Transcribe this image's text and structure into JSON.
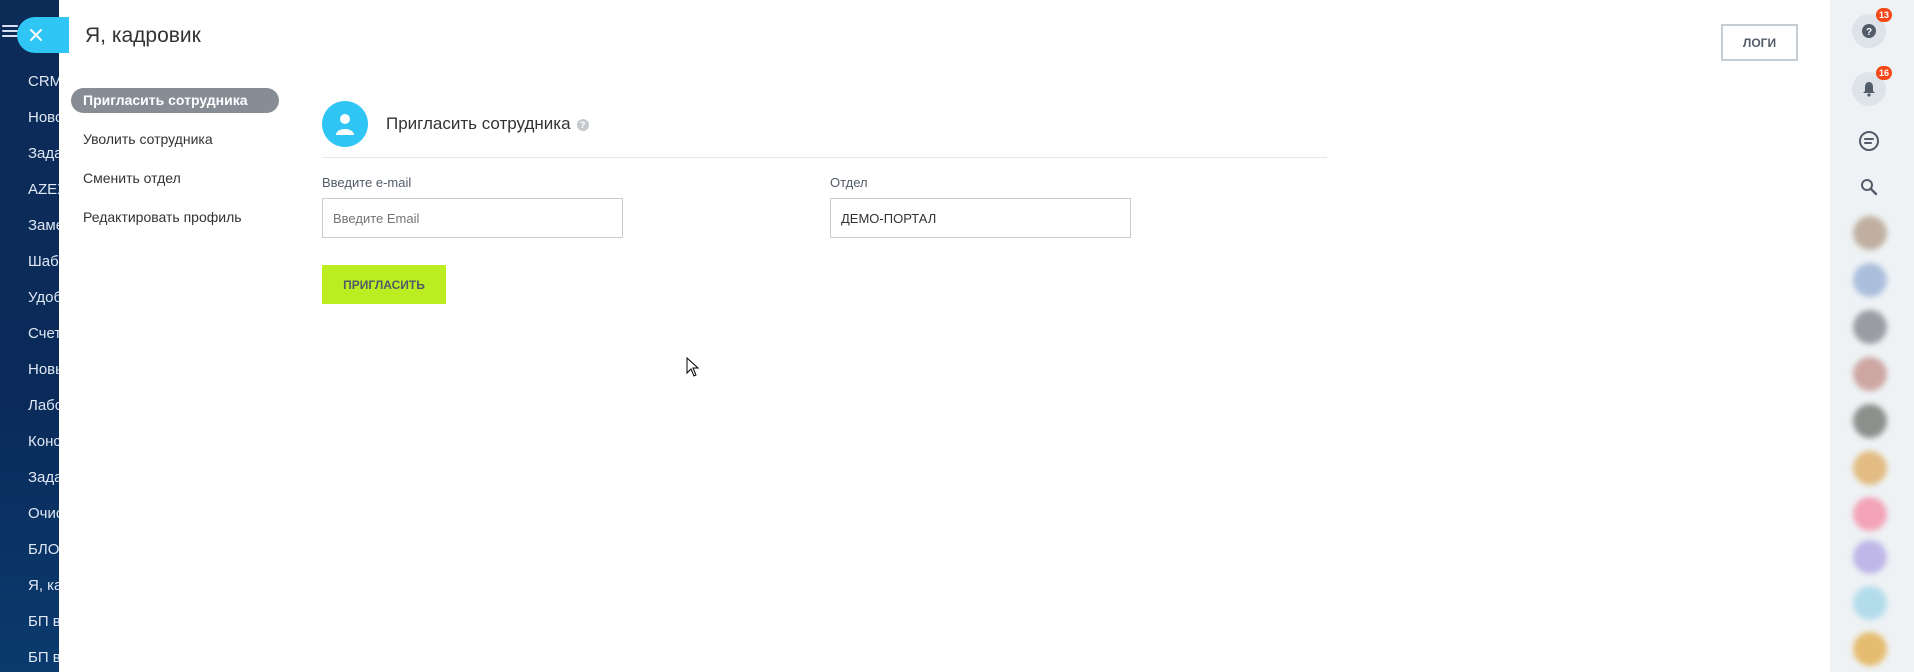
{
  "portal": {
    "menu": [
      "CRM",
      "Ново",
      "Зада",
      "AZEX",
      "Заме",
      "Шаб",
      "Удоб",
      "Счет",
      "Новы",
      "Лабо",
      "Конс",
      "Зада",
      "Очис",
      "БЛО",
      "Я, ка",
      "БП в",
      "БП в"
    ]
  },
  "page": {
    "title": "Я, кадровик",
    "logs_label": "ЛОГИ"
  },
  "local_menu": [
    {
      "label": "Пригласить сотрудника",
      "active": true
    },
    {
      "label": "Уволить сотрудника",
      "active": false
    },
    {
      "label": "Сменить отдел",
      "active": false
    },
    {
      "label": "Редактировать профиль",
      "active": false
    }
  ],
  "section": {
    "title": "Пригласить сотрудника",
    "help": "?"
  },
  "form": {
    "email_label": "Введите e-mail",
    "email_placeholder": "Введите Email",
    "email_value": "",
    "department_label": "Отдел",
    "department_value": "ДЕМО-ПОРТАЛ",
    "invite_label": "ПРИГЛАСИТЬ"
  },
  "right_bar": {
    "help_badge": "13",
    "notifications_badge": "16",
    "avatars": [
      "#b8a493",
      "#9fb6d8",
      "#8b8f95",
      "#c99a96",
      "#7b7f7a",
      "#e1b36f",
      "#f497ad",
      "#b7ade6",
      "#a9d9ea",
      "#e4b35a"
    ]
  },
  "colors": {
    "accent": "#2fc6f6",
    "invite": "#bbed21",
    "active_menu": "#868d95"
  }
}
